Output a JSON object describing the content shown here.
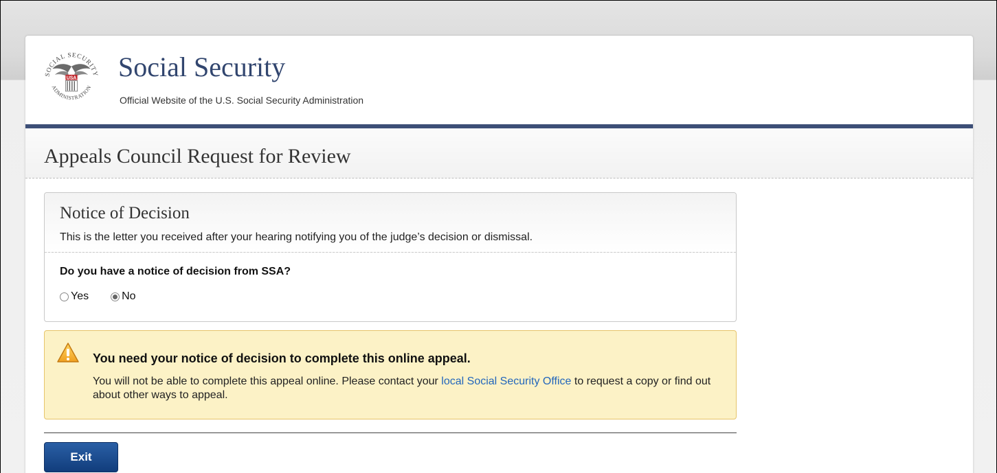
{
  "site": {
    "title": "Social Security",
    "subtitle": "Official Website of the U.S. Social Security Administration",
    "seal_text_top": "SOCIAL SECURITY",
    "seal_text_bottom": "ADMINISTRATION",
    "seal_center": "USA"
  },
  "page": {
    "title": "Appeals Council Request for Review"
  },
  "panel": {
    "title": "Notice of Decision",
    "description": "This is the letter you received after your hearing notifying you of the judge’s decision or dismissal.",
    "question": "Do you have a notice of decision from SSA?",
    "options": [
      {
        "label": "Yes",
        "selected": false
      },
      {
        "label": "No",
        "selected": true
      }
    ]
  },
  "alert": {
    "icon": "warning-icon",
    "title": "You need your notice of decision to complete this online appeal.",
    "body_before": "You will not be able to complete this appeal online. Please contact your ",
    "link_text": "local Social Security Office",
    "body_after": " to request a copy or find out about other ways to appeal.",
    "color_bg": "#fcf2c6",
    "color_border": "#e6c46a"
  },
  "actions": {
    "exit_label": "Exit"
  },
  "colors": {
    "brand": "#32466f",
    "header_rule": "#3d4f77",
    "button": "#1d4f93",
    "link": "#2266bb"
  }
}
